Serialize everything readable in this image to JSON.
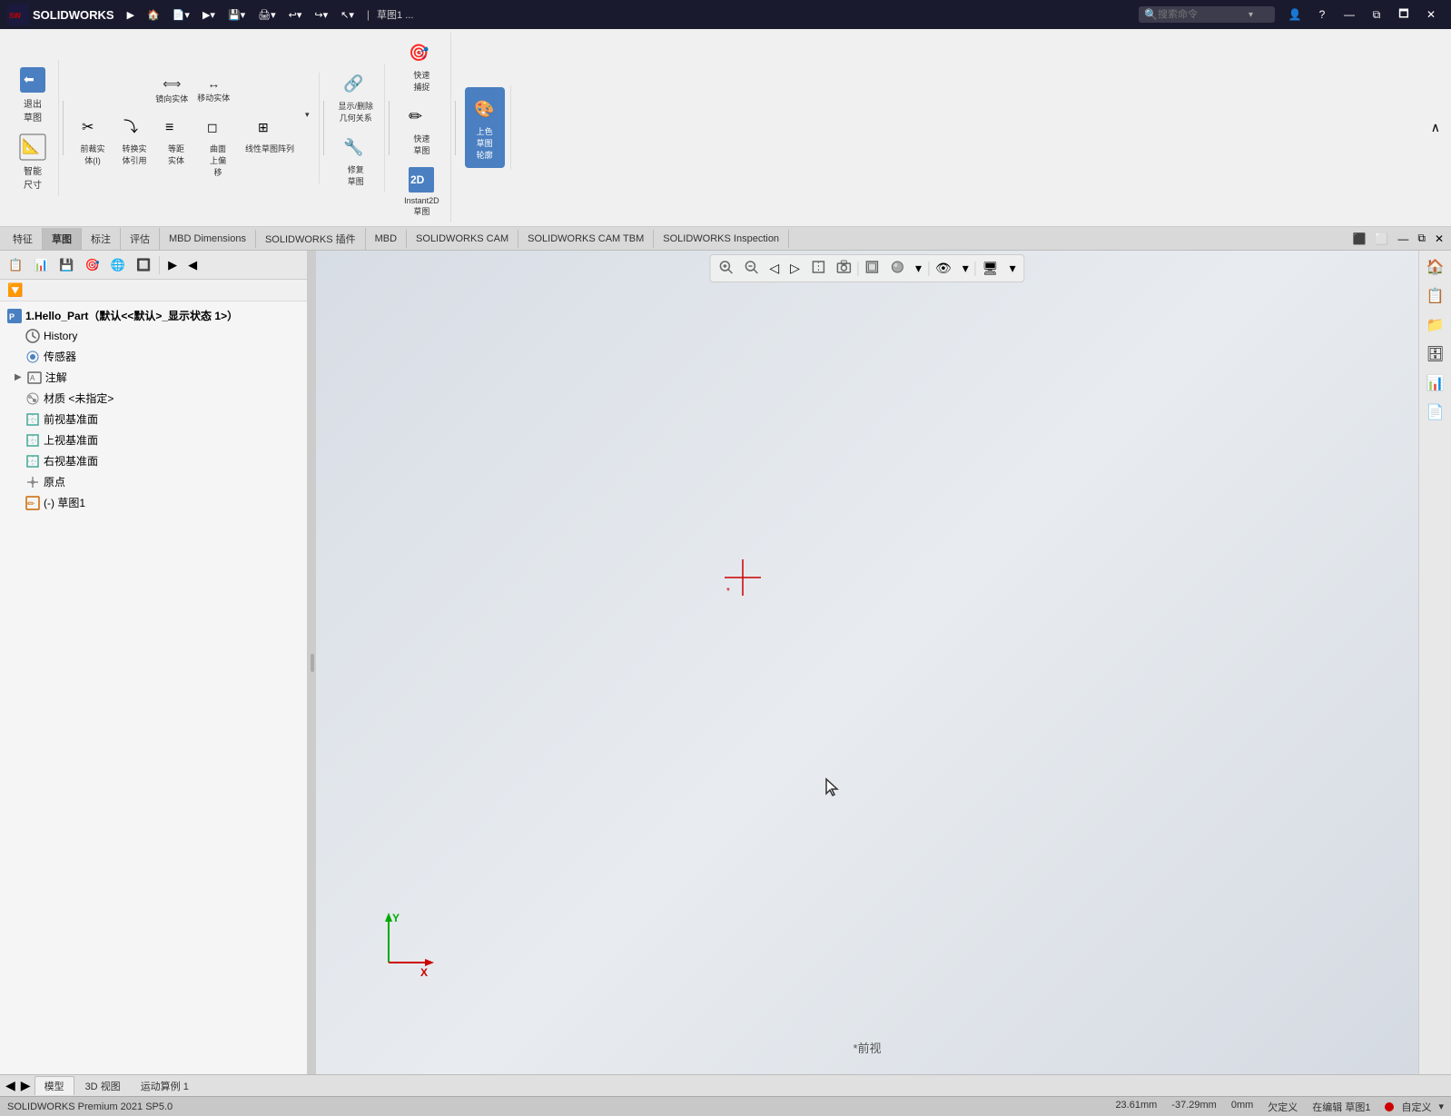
{
  "titleBar": {
    "appName": "SOLIDWORKS",
    "fileTitle": "草图1 ...",
    "searchPlaceholder": "搜索命令",
    "navButtons": [
      "▶",
      "🏠",
      "📄",
      "▶",
      "💾",
      "🖨",
      "↩",
      "↪",
      "↖"
    ]
  },
  "ribbonTabs": {
    "tabs": [
      "特征",
      "草图",
      "标注",
      "评估",
      "MBD Dimensions",
      "SOLIDWORKS 插件",
      "MBD",
      "SOLIDWORKS CAM",
      "SOLIDWORKS CAM TBM",
      "SOLIDWORKS Inspection"
    ],
    "activeTab": "草图"
  },
  "ribbonGroups": {
    "group1": {
      "buttons": [
        {
          "label": "退出\n草图",
          "icon": "⬅"
        },
        {
          "label": "智能\n尺寸",
          "icon": "📐"
        }
      ]
    },
    "group2": {
      "label": "镜向实体",
      "buttons": [
        {
          "label": "前裁实\n体(I)",
          "icon": "✂"
        },
        {
          "label": "转换实\n体引用",
          "icon": "🔄"
        },
        {
          "label": "等距\n实体",
          "icon": "≡"
        },
        {
          "label": "曲面\n上偏\n移",
          "icon": "◻"
        },
        {
          "label": "线性草图阵列",
          "icon": "⊞"
        }
      ]
    },
    "group3": {
      "buttons": [
        {
          "label": "显示/删除\n几何关系",
          "icon": "🔗"
        },
        {
          "label": "修复\n草图",
          "icon": "🔧"
        }
      ]
    },
    "group4": {
      "buttons": [
        {
          "label": "快速\n捕捉",
          "icon": "🎯"
        },
        {
          "label": "快速\n草图",
          "icon": "✏"
        },
        {
          "label": "Instant2D\n草图",
          "icon": "2D"
        }
      ]
    },
    "group5": {
      "label": "上色\n草图\n轮廓",
      "icon": "🎨"
    }
  },
  "featureTabs": [
    "特征",
    "草图",
    "标注",
    "评估",
    "MBD Dimensions",
    "SOLIDWORKS 插件",
    "MBD",
    "SOLIDWORKS CAM",
    "SOLIDWORKS CAM TBM",
    "SOLIDWORKS Inspection"
  ],
  "leftPanel": {
    "viewToolbar": {
      "buttons": [
        "📋",
        "📊",
        "💾",
        "🎯",
        "🌐",
        "🔲",
        "▶",
        "◀"
      ]
    },
    "treeTitle": "1.Hello_Part（默认<<默认>_显示状态 1>）",
    "treeItems": [
      {
        "label": "History",
        "icon": "🕐",
        "type": "history"
      },
      {
        "label": "传感器",
        "icon": "📡",
        "type": "sensor"
      },
      {
        "label": "注解",
        "icon": "📝",
        "type": "annotation",
        "hasArrow": true
      },
      {
        "label": "材质 <未指定>",
        "icon": "⚙",
        "type": "material"
      },
      {
        "label": "前视基准面",
        "icon": "⬜",
        "type": "plane"
      },
      {
        "label": "上视基准面",
        "icon": "⬜",
        "type": "plane"
      },
      {
        "label": "右视基准面",
        "icon": "⬜",
        "type": "plane"
      },
      {
        "label": "原点",
        "icon": "✦",
        "type": "origin"
      },
      {
        "label": "(-) 草图1",
        "icon": "✏",
        "type": "sketch"
      }
    ]
  },
  "viewport": {
    "label": "*前视",
    "bgColor": "#dde2ea"
  },
  "bottomTabs": {
    "tabs": [
      "模型",
      "3D 视图",
      "运动算例 1"
    ],
    "activeTab": "模型"
  },
  "statusBar": {
    "appInfo": "SOLIDWORKS Premium 2021 SP5.0",
    "coordX": "23.61mm",
    "coordY": "-37.29mm",
    "coordZ": "0mm",
    "status": "欠定义",
    "mode": "在编辑 草图1",
    "customize": "自定义"
  }
}
